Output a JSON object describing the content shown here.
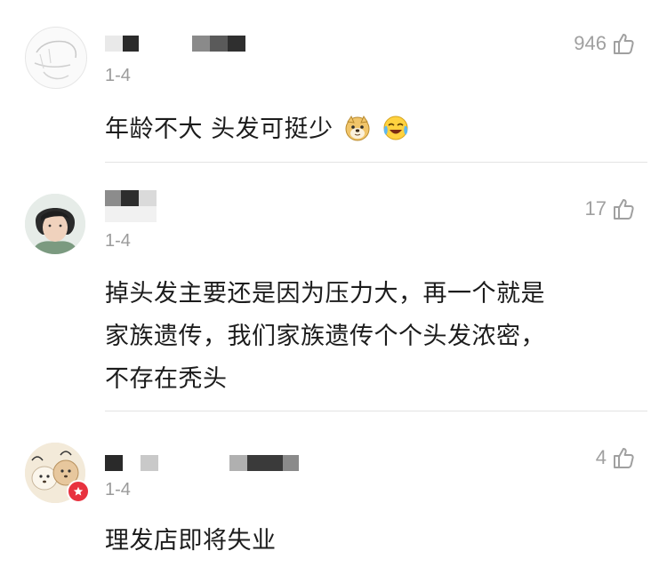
{
  "comments": [
    {
      "date": "1-4",
      "likes": "946",
      "text": "年龄不大 头发可挺少",
      "emojis": [
        "doge-emoji",
        "crying-laughing-emoji"
      ]
    },
    {
      "date": "1-4",
      "likes": "17",
      "text_lines": [
        "掉头发主要还是因为压力大，再一个就是",
        "家族遗传，我们家族遗传个个头发浓密，",
        "不存在秃头"
      ]
    },
    {
      "date": "1-4",
      "likes": "4",
      "text": "理发店即将失业",
      "badge_icon": "star-icon"
    }
  ],
  "colors": {
    "like_gray": "#a0a0a0",
    "date_gray": "#9b9b9b",
    "badge_red": "#e8323f"
  }
}
